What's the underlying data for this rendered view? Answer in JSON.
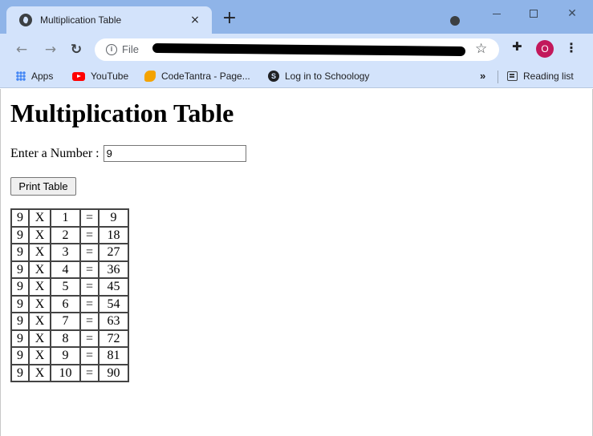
{
  "browser": {
    "tab_title": "Multiplication Table",
    "tab_close": "×",
    "new_tab": "+",
    "url_scheme": "File",
    "avatar_initial": "O",
    "bookmarks": [
      {
        "label": "Apps"
      },
      {
        "label": "YouTube"
      },
      {
        "label": "CodeTantra - Page..."
      },
      {
        "label": "Log in to Schoology"
      }
    ],
    "more_bookmarks": "»",
    "reading_list": "Reading list"
  },
  "page": {
    "heading": "Multiplication Table",
    "input_label": "Enter a Number :",
    "input_value": "9",
    "button_label": "Print Table",
    "table": {
      "rows": [
        {
          "a": "9",
          "op": "X",
          "b": "1",
          "eq": "=",
          "result": "9"
        },
        {
          "a": "9",
          "op": "X",
          "b": "2",
          "eq": "=",
          "result": "18"
        },
        {
          "a": "9",
          "op": "X",
          "b": "3",
          "eq": "=",
          "result": "27"
        },
        {
          "a": "9",
          "op": "X",
          "b": "4",
          "eq": "=",
          "result": "36"
        },
        {
          "a": "9",
          "op": "X",
          "b": "5",
          "eq": "=",
          "result": "45"
        },
        {
          "a": "9",
          "op": "X",
          "b": "6",
          "eq": "=",
          "result": "54"
        },
        {
          "a": "9",
          "op": "X",
          "b": "7",
          "eq": "=",
          "result": "63"
        },
        {
          "a": "9",
          "op": "X",
          "b": "8",
          "eq": "=",
          "result": "72"
        },
        {
          "a": "9",
          "op": "X",
          "b": "9",
          "eq": "=",
          "result": "81"
        },
        {
          "a": "9",
          "op": "X",
          "b": "10",
          "eq": "=",
          "result": "90"
        }
      ]
    }
  }
}
